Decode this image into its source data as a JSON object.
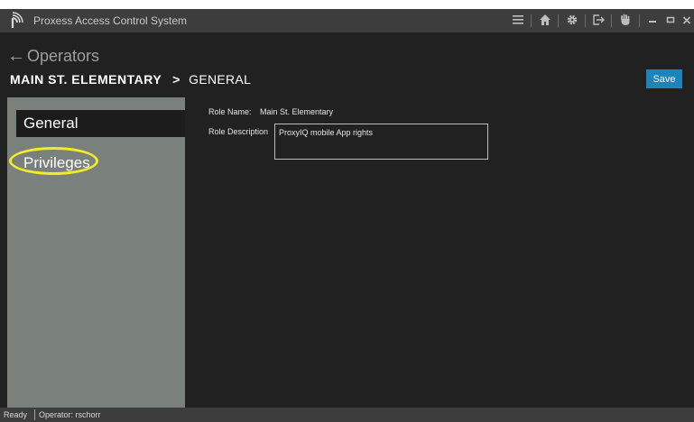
{
  "window": {
    "title": "Proxess Access Control System"
  },
  "titlebar_icons": [
    "menu-icon",
    "home-icon",
    "gear-icon",
    "logout-icon",
    "hand-icon",
    "minimize-icon",
    "maximize-icon",
    "close-icon"
  ],
  "header": {
    "back_label": "Operators",
    "breadcrumb_parent": "MAIN ST. ELEMENTARY",
    "breadcrumb_separator": ">",
    "breadcrumb_current": "GENERAL",
    "save_label": "Save"
  },
  "nav": {
    "items": [
      {
        "label": "General",
        "selected": true
      },
      {
        "label": "Privileges",
        "selected": false,
        "highlighted": true
      }
    ]
  },
  "form": {
    "role_name_label": "Role Name:",
    "role_name_value": "Main St. Elementary",
    "role_description_label": "Role Description",
    "role_description_value": "ProxyIQ mobile App rights"
  },
  "statusbar": {
    "status": "Ready",
    "operator": "Operator: rschorr"
  },
  "colors": {
    "titlebar": "#3d3d3d",
    "background": "#212121",
    "nav_panel": "#7a807c",
    "save_button": "#1b84bd",
    "highlight": "#f2ea2a"
  }
}
